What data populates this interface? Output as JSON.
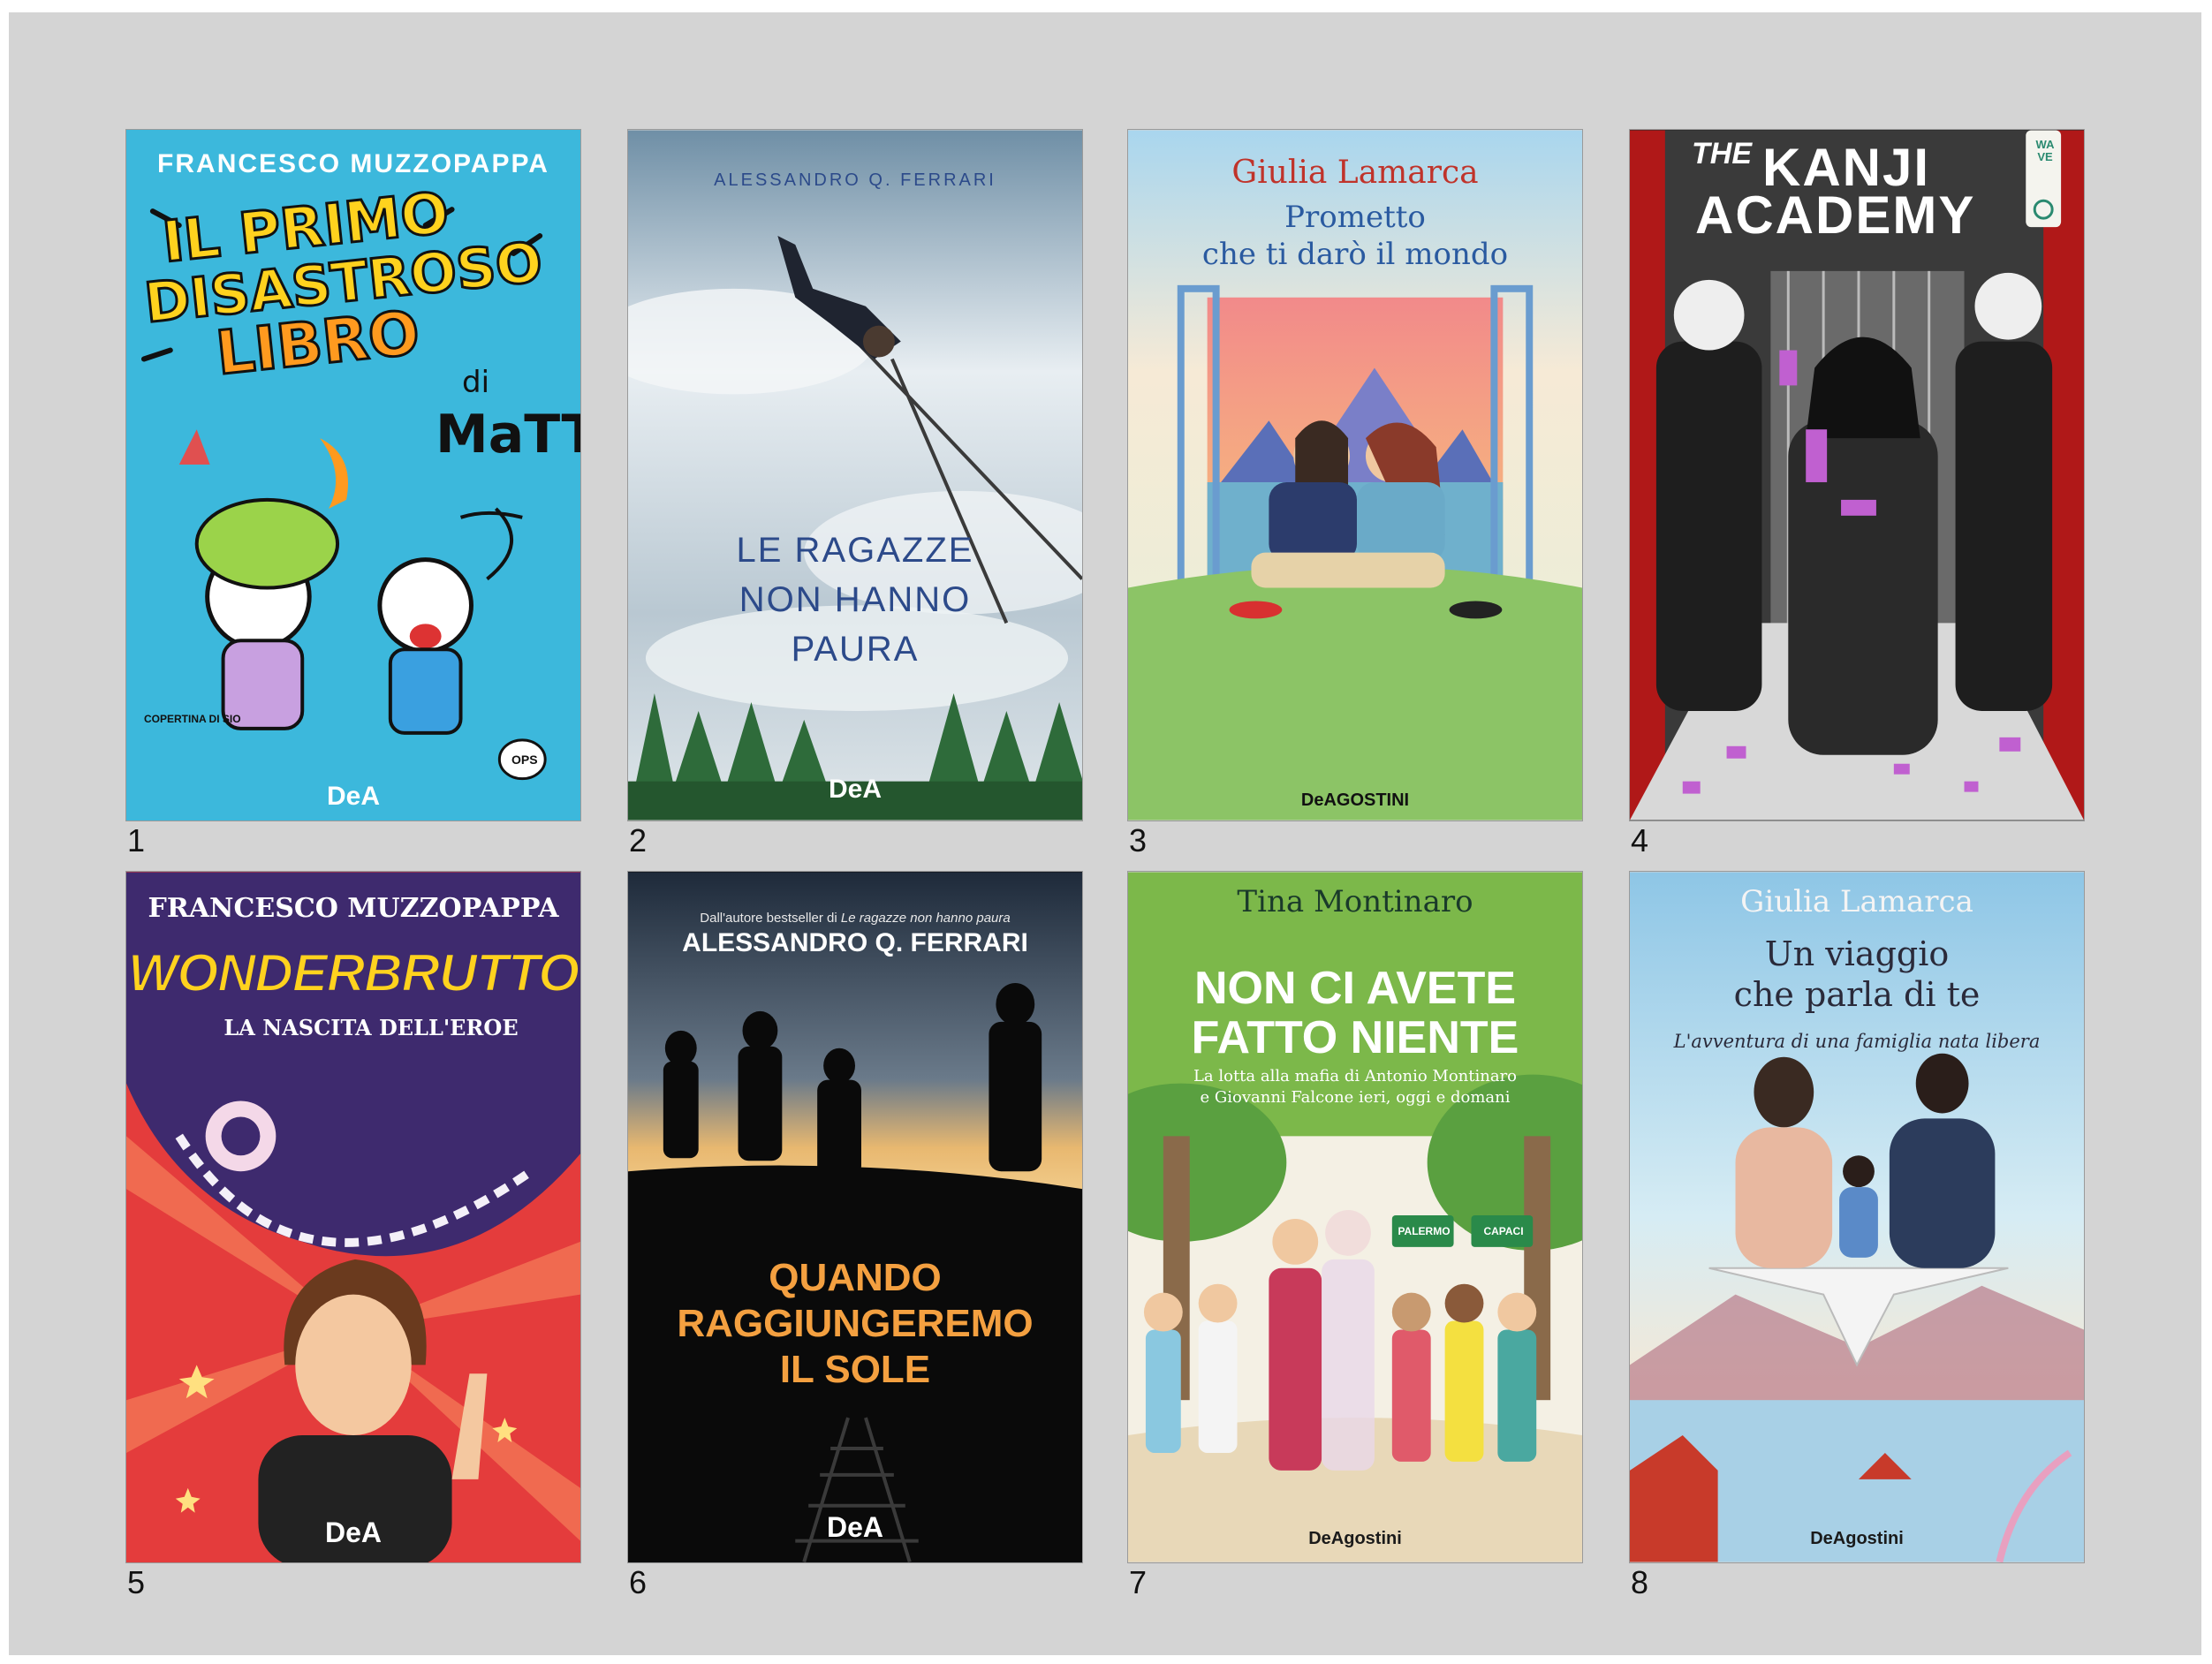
{
  "books": [
    {
      "number": "1",
      "author": "FRANCESCO MUZZOPAPPA",
      "title_lines": [
        "IL PRIMO",
        "DISASTROSO",
        "LIBRO"
      ],
      "subtitle": "di",
      "subtitle2": "MaTT",
      "credit": "COPERTINA DI",
      "credit_name": "SIO",
      "bubble": "OPS",
      "publisher": "DeA"
    },
    {
      "number": "2",
      "author": "ALESSANDRO Q. FERRARI",
      "title_lines": [
        "LE RAGAZZE",
        "NON HANNO",
        "PAURA"
      ],
      "publisher": "DeA"
    },
    {
      "number": "3",
      "author": "Giulia Lamarca",
      "title_lines": [
        "Prometto",
        "che ti darò il mondo"
      ],
      "publisher": "DeAGOSTINI"
    },
    {
      "number": "4",
      "title_lines": [
        "THE",
        "KANJI",
        "ACADEMY"
      ],
      "side_label": "WAVE"
    },
    {
      "number": "5",
      "author": "FRANCESCO MUZZOPAPPA",
      "title_lines": [
        "WONDERBRUTTO"
      ],
      "subtitle": "LA NASCITA DELL'EROE",
      "publisher": "DeA"
    },
    {
      "number": "6",
      "tagline_prefix": "Dall'autore bestseller di ",
      "tagline_title": "Le ragazze non hanno paura",
      "author": "ALESSANDRO Q. FERRARI",
      "title_lines": [
        "QUANDO",
        "RAGGIUNGEREMO",
        "IL SOLE"
      ],
      "publisher": "DeA"
    },
    {
      "number": "7",
      "author": "Tina Montinaro",
      "title_lines": [
        "NON CI AVETE",
        "FATTO NIENTE"
      ],
      "subtitle_lines": [
        "La lotta alla mafia di Antonio Montinaro",
        "e Giovanni Falcone ieri, oggi e domani"
      ],
      "signs": [
        "PALERMO",
        "CAPACI"
      ],
      "publisher": "DeAgostini"
    },
    {
      "number": "8",
      "author": "Giulia Lamarca",
      "title_lines": [
        "Un viaggio",
        "che parla di te"
      ],
      "subtitle": "L'avventura di una famiglia nata libera",
      "publisher": "DeAgostini"
    }
  ],
  "colors": {
    "panel": "#d4d4d4",
    "cover1": "#3cb8dc",
    "cover5": "#e43c3c",
    "cover6": "#121418",
    "cover7": "#7cb84a"
  }
}
